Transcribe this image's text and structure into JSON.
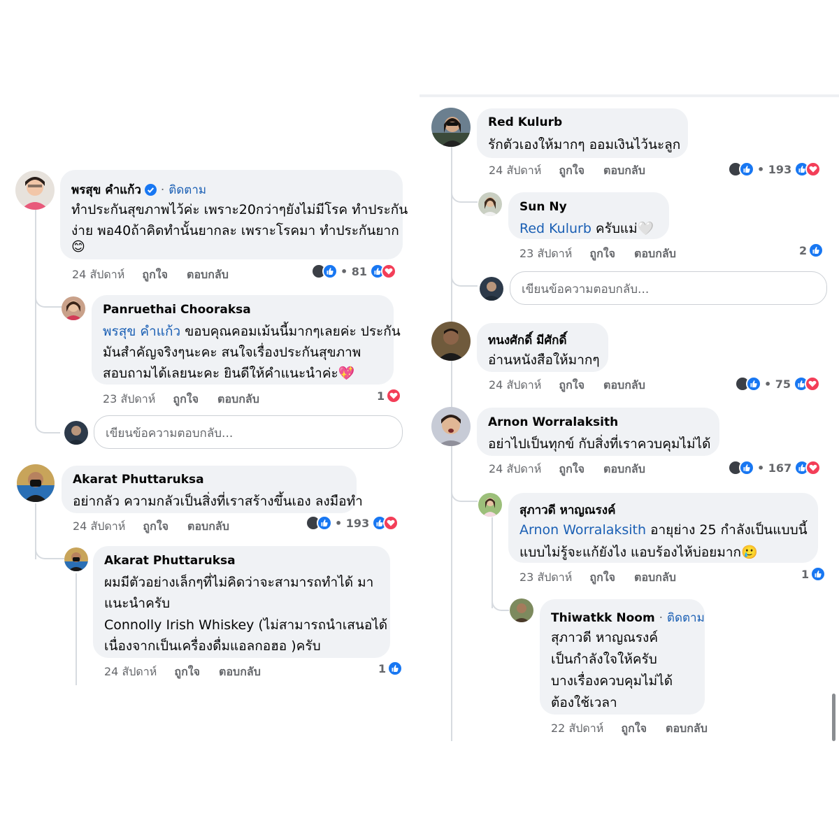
{
  "ui": {
    "like": "ถูกใจ",
    "reply": "ตอบกลับ",
    "follow": "ติดตาม",
    "follow_separator": "·",
    "reply_placeholder": "เขียนข้อความตอบกลับ...",
    "colors": {
      "like_blue": "#1877f2",
      "love_red": "#f33e58",
      "link_blue": "#1a5fb4",
      "bubble_bg": "#f0f2f5",
      "meta_gray": "#65676b"
    }
  },
  "left": {
    "c1": {
      "author": "พรสุข คำแก้ว",
      "verified": true,
      "lines": [
        "ทำประกันสุขภาพไว้ค่ะ เพราะ20กว่าๆยังไม่มีโรค ทำประกัน",
        "ง่าย พอ40ถ้าคิดทำนั้นยากละ เพราะโรคมา ทำประกันยาก",
        "😊"
      ],
      "time": "24 สัปดาห์",
      "reaction_count": "• 81"
    },
    "r1": {
      "author": "Panruethai Chooraksa",
      "mention": "พรสุข คำแก้ว",
      "line1_rest": " ขอบคุณคอมเม้นนี้มากๆเลยค่ะ ประกัน",
      "lines": [
        "มันสำคัญจริงๆนะคะ สนใจเรื่องประกันสุขภาพ",
        "สอบถามได้เลยนะคะ ยินดีให้คำแนะนำค่ะ💖"
      ],
      "time": "23 สัปดาห์",
      "reaction_count": "1"
    },
    "c2": {
      "author": "Akarat Phuttaruksa",
      "lines": [
        "อย่ากลัว ความกลัวเป็นสิ่งที่เราสร้างขึ้นเอง ลงมือทำ"
      ],
      "time": "24 สัปดาห์",
      "reaction_count": "• 193"
    },
    "r2": {
      "author": "Akarat Phuttaruksa",
      "lines": [
        "ผมมีตัวอย่างเล็กๆที่ไม่คิดว่าจะสามารถทำได้ มา",
        "แนะนำครับ",
        "Connolly Irish Whiskey (ไม่สามารถนำเสนอได้",
        "เนื่องจากเป็นเครื่องดื่มแอลกอฮอ )ครับ"
      ],
      "time": "24 สัปดาห์",
      "reaction_count": "1"
    }
  },
  "right": {
    "c1": {
      "author": "Red Kulurb",
      "lines": [
        "รักตัวเองให้มากๆ ออมเงินไว้นะลูก"
      ],
      "time": "24 สัปดาห์",
      "reaction_count": "• 193"
    },
    "r1": {
      "author": "Sun Ny",
      "mention": "Red Kulurb",
      "line1_rest": " ครับแม่🤍",
      "time": "23 สัปดาห์",
      "reaction_count": "2"
    },
    "c2": {
      "author": "ทนงศักดิ์ มีศักดิ์",
      "lines": [
        "อ่านหนังสือให้มากๆ"
      ],
      "time": "24 สัปดาห์",
      "reaction_count": "• 75"
    },
    "c3": {
      "author": "Arnon Worralaksith",
      "lines": [
        "อย่าไปเป็นทุกข์ กับสิ่งที่เราควบคุมไม่ได้"
      ],
      "time": "24 สัปดาห์",
      "reaction_count": "• 167"
    },
    "r2": {
      "author": "สุภาวดี หาญณรงค์",
      "mention": "Arnon Worralaksith",
      "line1_rest": " อายุย่าง 25 กำลังเป็นแบบนี้",
      "lines": [
        "แบบไม่รู้จะแก้ยังไง แอบร้องไห้บ่อยมาก🥲"
      ],
      "time": "23 สัปดาห์",
      "reaction_count": "1"
    },
    "r3": {
      "author": "Thiwatkk Noom",
      "lines": [
        "สุภาวดี หาญณรงค์",
        "เป็นกำลังใจให้ครับ",
        "บางเรื่องควบคุมไม่ได้",
        "ต้องใช้เวลา"
      ],
      "time": "22 สัปดาห์"
    }
  }
}
